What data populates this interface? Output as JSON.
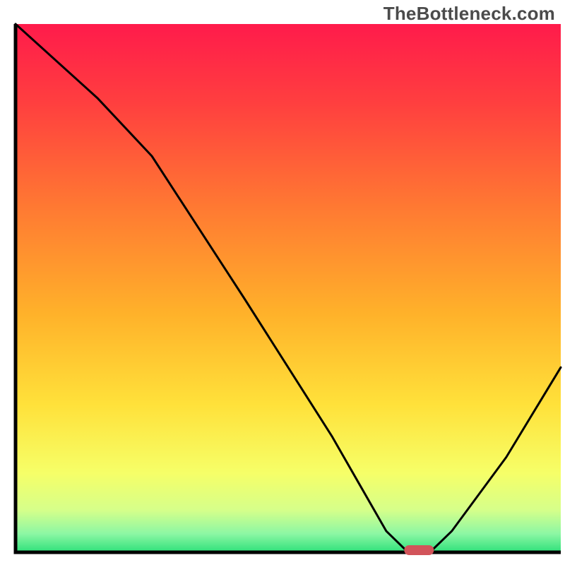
{
  "watermark": "TheBottleneck.com",
  "chart_data": {
    "type": "line",
    "title": "",
    "xlabel": "",
    "ylabel": "",
    "xlim": [
      0,
      100
    ],
    "ylim": [
      0,
      100
    ],
    "grid": false,
    "series": [
      {
        "name": "curve",
        "x": [
          0,
          15,
          25,
          42,
          58,
          68,
          72,
          76,
          80,
          90,
          100
        ],
        "values": [
          100,
          86,
          75,
          48,
          22,
          4,
          0,
          0,
          4,
          18,
          35
        ]
      }
    ],
    "marker": {
      "x": 74,
      "y": 0,
      "color": "#d2545a"
    },
    "gradient_stops": [
      {
        "offset": 0.0,
        "color": "#ff1b4b"
      },
      {
        "offset": 0.15,
        "color": "#ff3f3f"
      },
      {
        "offset": 0.35,
        "color": "#ff7a32"
      },
      {
        "offset": 0.55,
        "color": "#ffb22a"
      },
      {
        "offset": 0.72,
        "color": "#ffe13a"
      },
      {
        "offset": 0.85,
        "color": "#f6ff68"
      },
      {
        "offset": 0.92,
        "color": "#d6ff8a"
      },
      {
        "offset": 0.965,
        "color": "#8cf7a4"
      },
      {
        "offset": 1.0,
        "color": "#2ee07a"
      }
    ]
  }
}
